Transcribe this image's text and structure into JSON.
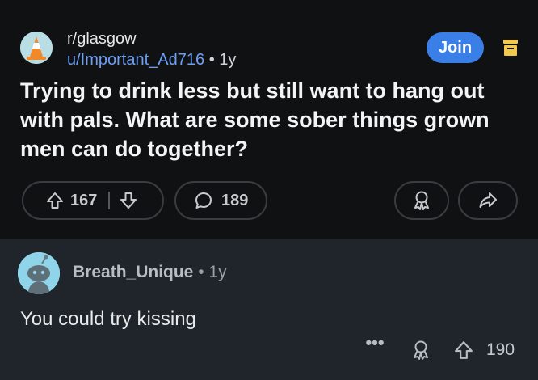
{
  "post": {
    "subreddit": "r/glasgow",
    "author": "u/Important_Ad716",
    "separator": "•",
    "age": "1y",
    "join_label": "Join",
    "title": "Trying to drink less but still want to hang out with pals. What are some sober things grown men can do together?",
    "votes": "167",
    "comments": "189"
  },
  "comment": {
    "author": "Breath_Unique",
    "separator": "•",
    "age": "1y",
    "body": "You could try kissing",
    "more": "•••",
    "votes": "190"
  },
  "colors": {
    "join": "#3a7ee8",
    "username_link": "#6d9ff5",
    "mod_icon": "#f2c94c",
    "cone": "#f0882c"
  },
  "icons": [
    "traffic-cone-avatar",
    "mod-queue-icon",
    "upvote-icon",
    "downvote-icon",
    "comment-bubble-icon",
    "award-icon",
    "share-icon",
    "snoo-avatar",
    "more-icon"
  ]
}
